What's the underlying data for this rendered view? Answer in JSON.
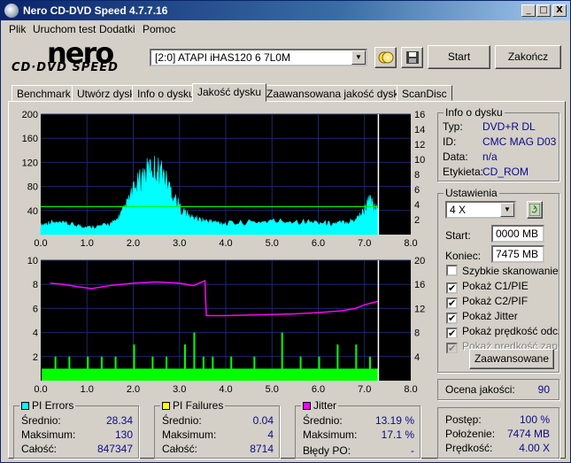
{
  "window": {
    "title": "Nero CD-DVD Speed 4.7.7.16",
    "min": "_",
    "max": "□",
    "close": "X"
  },
  "menu": [
    "Plik",
    "Uruchom test",
    "Dodatki",
    "Pomoc"
  ],
  "logo": {
    "top": "nero",
    "bottom": "CD·DVD SPEED"
  },
  "drive": {
    "value": "[2:0]   ATAPI iHAS120   6 7L0M"
  },
  "toolbar": {
    "start": "Start",
    "close": "Zakończ"
  },
  "tabs": [
    "Benchmark",
    "Utwórz dysk",
    "Info o dysku",
    "Jakość dysku",
    "Zaawansowana jakość dysku",
    "ScanDisc"
  ],
  "active_tab": 3,
  "disc_info": {
    "title": "Info o dysku",
    "rows": [
      {
        "label": "Typ:",
        "value": "DVD+R DL"
      },
      {
        "label": "ID:",
        "value": "CMC MAG D03"
      },
      {
        "label": "Data:",
        "value": "n/a"
      },
      {
        "label": "Etykieta:",
        "value": "CD_ROM"
      }
    ]
  },
  "settings": {
    "title": "Ustawienia",
    "speed": "4 X",
    "start_label": "Start:",
    "start_value": "0000 MB",
    "end_label": "Koniec:",
    "end_value": "7475 MB",
    "checks": [
      {
        "label": "Szybkie skanowanie",
        "checked": false,
        "disabled": false
      },
      {
        "label": "Pokaż C1/PIE",
        "checked": true,
        "disabled": false
      },
      {
        "label": "Pokaż C2/PIF",
        "checked": true,
        "disabled": false
      },
      {
        "label": "Pokaż Jitter",
        "checked": true,
        "disabled": false
      },
      {
        "label": "Pokaż prędkość odczytu",
        "checked": true,
        "disabled": false
      },
      {
        "label": "Pokaż prędkość zapisu",
        "checked": true,
        "disabled": true
      }
    ],
    "advanced": "Zaawansowane"
  },
  "quality": {
    "label": "Ocena jakości:",
    "value": "90"
  },
  "pi_errors": {
    "title": "PI Errors",
    "color": "#00ffff",
    "avg_label": "Średnio:",
    "avg": "28.34",
    "max_label": "Maksimum:",
    "max": "130",
    "total_label": "Całość:",
    "total": "847347"
  },
  "pi_failures": {
    "title": "PI Failures",
    "color": "#ffff00",
    "avg_label": "Średnio:",
    "avg": "0.04",
    "max_label": "Maksimum:",
    "max": "4",
    "total_label": "Całość:",
    "total": "8714"
  },
  "jitter": {
    "title": "Jitter",
    "color": "#ff00ff",
    "avg_label": "Średnio:",
    "avg": "13.19 %",
    "max_label": "Maksimum:",
    "max": "17.1 %",
    "po_label": "Błędy PO:",
    "po": "-"
  },
  "progress": {
    "progress_label": "Postęp:",
    "progress": "100 %",
    "position_label": "Położenie:",
    "position": "7474 MB",
    "speed_label": "Prędkość:",
    "speed": "4.00 X"
  },
  "chart_data": [
    {
      "type": "area",
      "x_ticks": [
        "0.0",
        "1.0",
        "2.0",
        "3.0",
        "4.0",
        "5.0",
        "6.0",
        "7.0",
        "8.0"
      ],
      "y_left_ticks": [
        "200",
        "160",
        "120",
        "80",
        "40"
      ],
      "y_right_ticks": [
        "16",
        "14",
        "12",
        "10",
        "8",
        "6",
        "4",
        "2"
      ],
      "xlim": [
        0,
        8
      ],
      "ylim_left": [
        0,
        200
      ],
      "ylim_right": [
        0,
        16
      ],
      "series": [
        {
          "color": "#00ffff",
          "x": [
            0,
            0.2,
            0.5,
            0.8,
            1.0,
            1.3,
            1.6,
            1.8,
            2.0,
            2.2,
            2.4,
            2.6,
            2.8,
            3.0,
            3.2,
            3.4,
            3.6,
            3.8,
            4.0,
            4.5,
            5.0,
            5.5,
            6.0,
            6.3,
            6.6,
            6.8,
            7.0,
            7.1,
            7.2,
            7.3
          ],
          "y": [
            15,
            20,
            18,
            15,
            12,
            14,
            20,
            40,
            70,
            95,
            110,
            105,
            75,
            45,
            30,
            25,
            22,
            20,
            18,
            20,
            22,
            22,
            20,
            18,
            20,
            25,
            40,
            55,
            45,
            40
          ]
        },
        {
          "color": "#00ff00",
          "x": [
            0,
            7.3
          ],
          "y": [
            3.7,
            3.7
          ]
        }
      ],
      "marker_x": 7.3
    },
    {
      "type": "bar",
      "x_ticks": [
        "0.0",
        "1.0",
        "2.0",
        "3.0",
        "4.0",
        "5.0",
        "6.0",
        "7.0",
        "8.0"
      ],
      "y_left_ticks": [
        "10",
        "8",
        "6",
        "4",
        "2"
      ],
      "y_right_ticks": [
        "20",
        "16",
        "12",
        "8",
        "4"
      ],
      "xlim": [
        0,
        8
      ],
      "ylim_left": [
        0,
        10
      ],
      "ylim_right": [
        0,
        20
      ],
      "series": [
        {
          "color": "#ff00ff",
          "x": [
            0.2,
            0.5,
            0.8,
            1.1,
            1.5,
            2.0,
            2.5,
            3.0,
            3.3,
            3.55,
            3.58,
            4.0,
            4.5,
            5.0,
            5.5,
            6.0,
            6.5,
            6.8,
            7.0,
            7.2,
            7.3
          ],
          "y": [
            16.2,
            16.0,
            15.6,
            15.3,
            15.8,
            16.2,
            16.4,
            16.2,
            15.8,
            16.6,
            10.8,
            10.8,
            10.9,
            11.0,
            11.1,
            11.3,
            11.6,
            12.0,
            12.6,
            13.0,
            13.2
          ]
        },
        {
          "color": "#00ff00",
          "base": 1,
          "spikes": [
            [
              0.3,
              2
            ],
            [
              0.6,
              2
            ],
            [
              1.0,
              2
            ],
            [
              1.3,
              2
            ],
            [
              1.6,
              2
            ],
            [
              2.0,
              3
            ],
            [
              2.4,
              2
            ],
            [
              2.7,
              2
            ],
            [
              3.1,
              3
            ],
            [
              3.3,
              4
            ],
            [
              3.5,
              2
            ],
            [
              3.7,
              2
            ],
            [
              4.1,
              2
            ],
            [
              4.6,
              2
            ],
            [
              5.2,
              4
            ],
            [
              5.6,
              2
            ],
            [
              6.0,
              2
            ],
            [
              6.4,
              3
            ],
            [
              6.8,
              3
            ],
            [
              7.1,
              2
            ]
          ]
        }
      ],
      "marker_x": 7.3
    }
  ]
}
